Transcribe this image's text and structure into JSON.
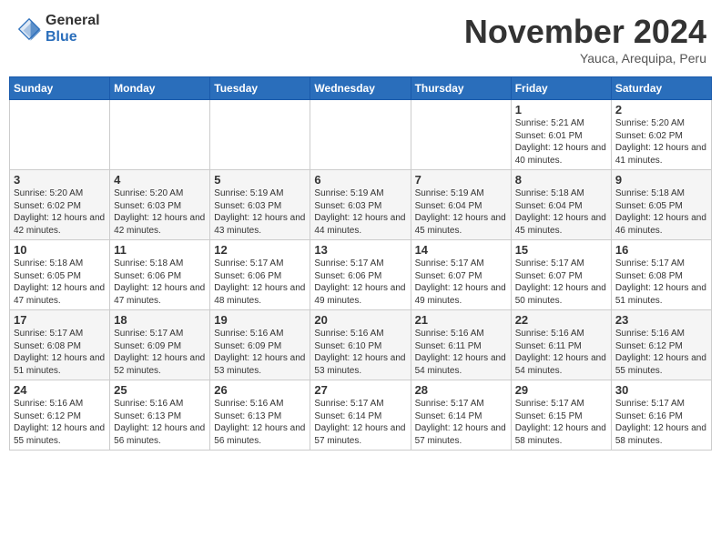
{
  "header": {
    "logo_general": "General",
    "logo_blue": "Blue",
    "month_title": "November 2024",
    "location": "Yauca, Arequipa, Peru"
  },
  "days_of_week": [
    "Sunday",
    "Monday",
    "Tuesday",
    "Wednesday",
    "Thursday",
    "Friday",
    "Saturday"
  ],
  "weeks": [
    [
      {
        "day": "",
        "info": ""
      },
      {
        "day": "",
        "info": ""
      },
      {
        "day": "",
        "info": ""
      },
      {
        "day": "",
        "info": ""
      },
      {
        "day": "",
        "info": ""
      },
      {
        "day": "1",
        "info": "Sunrise: 5:21 AM\nSunset: 6:01 PM\nDaylight: 12 hours and 40 minutes."
      },
      {
        "day": "2",
        "info": "Sunrise: 5:20 AM\nSunset: 6:02 PM\nDaylight: 12 hours and 41 minutes."
      }
    ],
    [
      {
        "day": "3",
        "info": "Sunrise: 5:20 AM\nSunset: 6:02 PM\nDaylight: 12 hours and 42 minutes."
      },
      {
        "day": "4",
        "info": "Sunrise: 5:20 AM\nSunset: 6:03 PM\nDaylight: 12 hours and 42 minutes."
      },
      {
        "day": "5",
        "info": "Sunrise: 5:19 AM\nSunset: 6:03 PM\nDaylight: 12 hours and 43 minutes."
      },
      {
        "day": "6",
        "info": "Sunrise: 5:19 AM\nSunset: 6:03 PM\nDaylight: 12 hours and 44 minutes."
      },
      {
        "day": "7",
        "info": "Sunrise: 5:19 AM\nSunset: 6:04 PM\nDaylight: 12 hours and 45 minutes."
      },
      {
        "day": "8",
        "info": "Sunrise: 5:18 AM\nSunset: 6:04 PM\nDaylight: 12 hours and 45 minutes."
      },
      {
        "day": "9",
        "info": "Sunrise: 5:18 AM\nSunset: 6:05 PM\nDaylight: 12 hours and 46 minutes."
      }
    ],
    [
      {
        "day": "10",
        "info": "Sunrise: 5:18 AM\nSunset: 6:05 PM\nDaylight: 12 hours and 47 minutes."
      },
      {
        "day": "11",
        "info": "Sunrise: 5:18 AM\nSunset: 6:06 PM\nDaylight: 12 hours and 47 minutes."
      },
      {
        "day": "12",
        "info": "Sunrise: 5:17 AM\nSunset: 6:06 PM\nDaylight: 12 hours and 48 minutes."
      },
      {
        "day": "13",
        "info": "Sunrise: 5:17 AM\nSunset: 6:06 PM\nDaylight: 12 hours and 49 minutes."
      },
      {
        "day": "14",
        "info": "Sunrise: 5:17 AM\nSunset: 6:07 PM\nDaylight: 12 hours and 49 minutes."
      },
      {
        "day": "15",
        "info": "Sunrise: 5:17 AM\nSunset: 6:07 PM\nDaylight: 12 hours and 50 minutes."
      },
      {
        "day": "16",
        "info": "Sunrise: 5:17 AM\nSunset: 6:08 PM\nDaylight: 12 hours and 51 minutes."
      }
    ],
    [
      {
        "day": "17",
        "info": "Sunrise: 5:17 AM\nSunset: 6:08 PM\nDaylight: 12 hours and 51 minutes."
      },
      {
        "day": "18",
        "info": "Sunrise: 5:17 AM\nSunset: 6:09 PM\nDaylight: 12 hours and 52 minutes."
      },
      {
        "day": "19",
        "info": "Sunrise: 5:16 AM\nSunset: 6:09 PM\nDaylight: 12 hours and 53 minutes."
      },
      {
        "day": "20",
        "info": "Sunrise: 5:16 AM\nSunset: 6:10 PM\nDaylight: 12 hours and 53 minutes."
      },
      {
        "day": "21",
        "info": "Sunrise: 5:16 AM\nSunset: 6:11 PM\nDaylight: 12 hours and 54 minutes."
      },
      {
        "day": "22",
        "info": "Sunrise: 5:16 AM\nSunset: 6:11 PM\nDaylight: 12 hours and 54 minutes."
      },
      {
        "day": "23",
        "info": "Sunrise: 5:16 AM\nSunset: 6:12 PM\nDaylight: 12 hours and 55 minutes."
      }
    ],
    [
      {
        "day": "24",
        "info": "Sunrise: 5:16 AM\nSunset: 6:12 PM\nDaylight: 12 hours and 55 minutes."
      },
      {
        "day": "25",
        "info": "Sunrise: 5:16 AM\nSunset: 6:13 PM\nDaylight: 12 hours and 56 minutes."
      },
      {
        "day": "26",
        "info": "Sunrise: 5:16 AM\nSunset: 6:13 PM\nDaylight: 12 hours and 56 minutes."
      },
      {
        "day": "27",
        "info": "Sunrise: 5:17 AM\nSunset: 6:14 PM\nDaylight: 12 hours and 57 minutes."
      },
      {
        "day": "28",
        "info": "Sunrise: 5:17 AM\nSunset: 6:14 PM\nDaylight: 12 hours and 57 minutes."
      },
      {
        "day": "29",
        "info": "Sunrise: 5:17 AM\nSunset: 6:15 PM\nDaylight: 12 hours and 58 minutes."
      },
      {
        "day": "30",
        "info": "Sunrise: 5:17 AM\nSunset: 6:16 PM\nDaylight: 12 hours and 58 minutes."
      }
    ]
  ]
}
